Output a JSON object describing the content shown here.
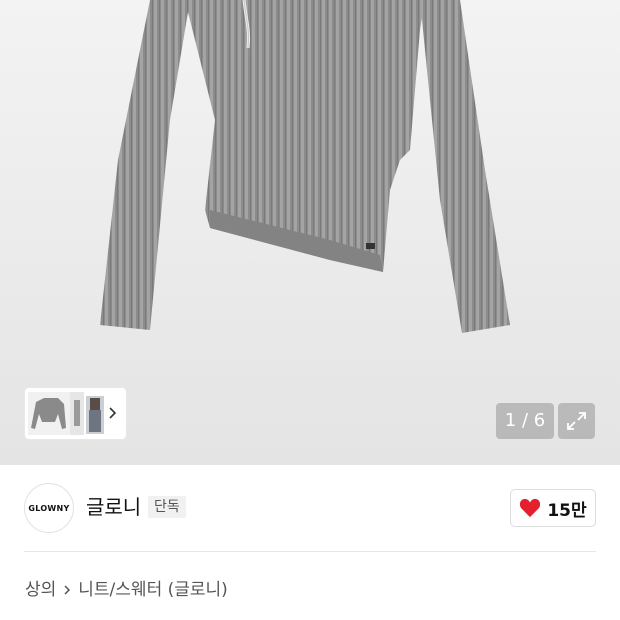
{
  "gallery": {
    "counter": "1 / 6",
    "main_image": "grey-ribbed-knit-sweater",
    "thumbnail_images": [
      "grey-sweater-thumb",
      "model-thumb"
    ],
    "thumb_more_icon": "chevron-right-icon",
    "expand_icon": "expand-arrows-icon"
  },
  "brand": {
    "logo_text": "GLOWNY",
    "name": "글로니",
    "badge": "단독"
  },
  "like": {
    "icon": "heart-icon",
    "count": "15만",
    "color": "#e5202e"
  },
  "breadcrumb": {
    "items": [
      "상의",
      "니트/스웨터 (글로니)"
    ],
    "separator_icon": "chevron-right-icon"
  }
}
